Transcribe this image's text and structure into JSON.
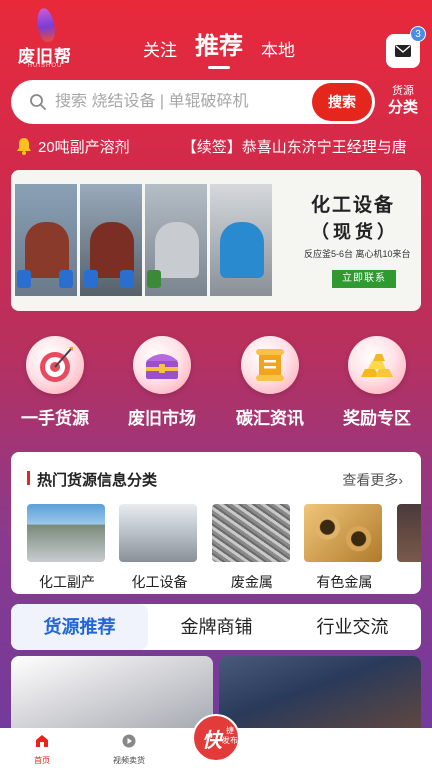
{
  "header": {
    "logo_text": "废旧帮",
    "logo_subtext": "HUISHOU",
    "tabs": [
      {
        "label": "关注"
      },
      {
        "label": "推荐",
        "active": true
      },
      {
        "label": "本地"
      }
    ],
    "message_badge": "3"
  },
  "search": {
    "placeholder": "搜索 烧结设备 | 单辊破碎机",
    "button_label": "搜索",
    "category_line1": "货源",
    "category_line2": "分类"
  },
  "marquee": {
    "items": [
      "20吨副产溶剂",
      "【续签】恭喜山东济宁王经理与唐"
    ]
  },
  "banner": {
    "title": "化工设备",
    "subtitle": "（现货）",
    "note": "反应釜5-6台   离心机10来台",
    "button_label": "立即联系"
  },
  "quick_entries": [
    {
      "label": "一手货源",
      "icon": "target-icon"
    },
    {
      "label": "废旧市场",
      "icon": "treasure-chest-icon"
    },
    {
      "label": "碳汇资讯",
      "icon": "scroll-icon"
    },
    {
      "label": "奖励专区",
      "icon": "gold-bars-icon"
    }
  ],
  "hot": {
    "title": "热门货源信息分类",
    "more": "查看更多",
    "items": [
      {
        "label": "化工副产"
      },
      {
        "label": "化工设备"
      },
      {
        "label": "废金属"
      },
      {
        "label": "有色金属"
      },
      {
        "label": "机"
      }
    ]
  },
  "tabs": [
    {
      "label": "货源推荐",
      "active": true
    },
    {
      "label": "金牌商铺"
    },
    {
      "label": "行业交流"
    }
  ],
  "bottom_nav": {
    "home": "首页",
    "video": "视频卖货",
    "fab_main": "快",
    "fab_sub1": "捷",
    "fab_sub2": "发布"
  },
  "colors": {
    "brand_red": "#e4261c",
    "tab_active_blue": "#2266d6",
    "banner_button_green": "#2f9a2f"
  }
}
